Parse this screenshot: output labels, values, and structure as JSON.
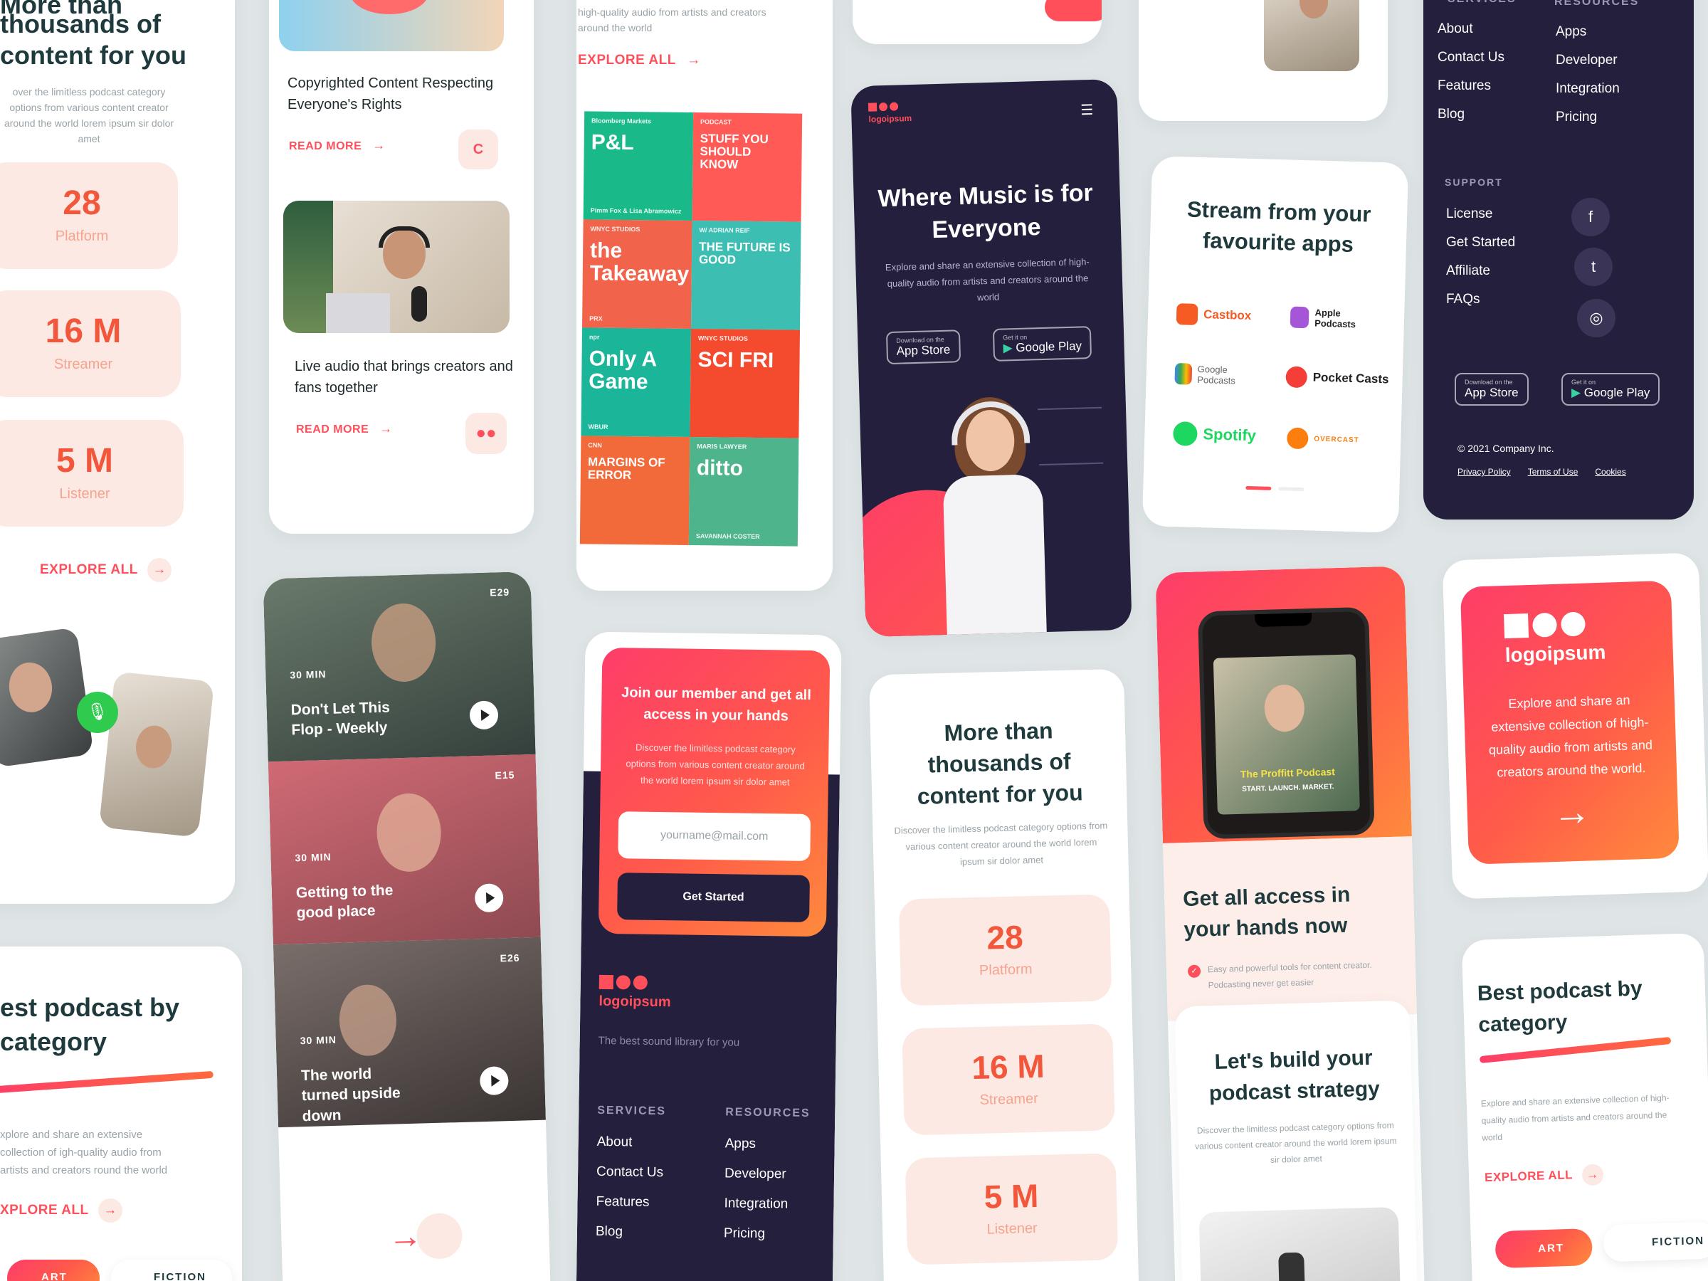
{
  "col1": {
    "heading_top": "More than",
    "heading": "thousands of content for you",
    "desc": "over the limitless podcast category options from various content creator around the world lorem ipsum sir dolor amet",
    "stats": [
      {
        "num": "28",
        "label": "Platform"
      },
      {
        "num": "16 M",
        "label": "Streamer"
      },
      {
        "num": "5 M",
        "label": "Listener"
      }
    ],
    "explore": "EXPLORE ALL",
    "best_title": "est podcast by category",
    "best_desc": "xplore and share an extensive collection of igh-quality audio from artists and creators round the world",
    "explore2": "XPLORE ALL",
    "chips": [
      "ART",
      "FICTION"
    ]
  },
  "col2": {
    "article1": "Copyrighted Content Respecting Everyone's Rights",
    "read_more": "READ MORE",
    "article2": "Live audio that brings creators and fans together",
    "episodes": [
      {
        "code": "E29",
        "dur": "30 MIN",
        "title": "Don't Let This Flop - Weekly"
      },
      {
        "code": "E15",
        "dur": "30 MIN",
        "title": "Getting to the good place"
      },
      {
        "code": "E26",
        "dur": "30 MIN",
        "title": "The world turned upside down"
      }
    ]
  },
  "col3": {
    "top_desc": "high-quality audio from artists and creators around the world",
    "explore": "EXPLORE ALL",
    "tiles": [
      {
        "title": "P&L",
        "sub": "Bloomberg Markets",
        "foot": "Pimm Fox & Lisa Abramowicz",
        "color": "#19b98a"
      },
      {
        "title": "STUFF YOU SHOULD KNOW",
        "sub": "PODCAST",
        "foot": "",
        "color": "#ff5a55"
      },
      {
        "title": "the Takeaway",
        "sub": "WNYC STUDIOS",
        "foot": "PRX",
        "color": "#f1634b"
      },
      {
        "title": "THE FUTURE IS GOOD",
        "sub": "W/ ADRIAN REIF",
        "foot": "",
        "color": "#3cbfb2"
      },
      {
        "title": "Only A Game",
        "sub": "npr",
        "foot": "WBUR",
        "color": "#1bb59a"
      },
      {
        "title": "SCI FRI",
        "sub": "WNYC STUDIOS",
        "foot": "",
        "color": "#f44a2e"
      },
      {
        "title": "MARGINS OF ERROR",
        "sub": "CNN",
        "foot": "",
        "color": "#f26a3a"
      },
      {
        "title": "ditto",
        "sub": "MARIS LAWYER",
        "foot": "SAVANNAH COSTER",
        "color": "#4eb48c"
      }
    ],
    "join_title": "Join our member and get all access in your hands",
    "join_desc": "Discover the limitless podcast category options from various content creator around the world lorem ipsum sir dolor amet",
    "email_placeholder": "yourname@mail.com",
    "get_started": "Get Started",
    "logo": "logoipsum",
    "tagline": "The best sound library for you",
    "services_h": "SERVICES",
    "resources_h": "RESOURCES",
    "services": [
      "About",
      "Contact Us",
      "Features",
      "Blog"
    ],
    "resources": [
      "Apps",
      "Developer",
      "Integration",
      "Pricing"
    ]
  },
  "col4": {
    "logo": "logoipsum",
    "hero": "Where Music is for Everyone",
    "hero_desc": "Explore and share an extensive collection of high-quality audio from artists and creators around the world",
    "app_store_small": "Download on the",
    "app_store": "App Store",
    "play_small": "Get it on",
    "play": "Google Play",
    "more_title": "More than thousands of content for you",
    "more_desc": "Discover the limitless podcast category options from various content creator around the world lorem ipsum sir dolor amet",
    "stats": [
      {
        "num": "28",
        "label": "Platform"
      },
      {
        "num": "16 M",
        "label": "Streamer"
      },
      {
        "num": "5 M",
        "label": "Listener"
      }
    ]
  },
  "col5": {
    "stream_title": "Stream from your favourite apps",
    "apps": [
      "Castbox",
      "Apple Podcasts",
      "Google Podcasts",
      "Pocket Casts",
      "Spotify",
      "OVERCAST"
    ],
    "phone_podcast": "The Proffitt Podcast",
    "phone_podcast_sub": "START. LAUNCH. MARKET.",
    "access_title": "Get all access in your hands now",
    "access_desc": "Easy and powerful tools for content creator. Podcasting never get easier",
    "strategy_title": "Let's build your podcast strategy",
    "strategy_desc": "Discover the limitless podcast category options from various content creator around the world lorem ipsum sir dolor amet"
  },
  "col6": {
    "services_h": "SERVICES",
    "resources_h": "RESOURCES",
    "services": [
      "About",
      "Contact Us",
      "Features",
      "Blog"
    ],
    "resources": [
      "Apps",
      "Developer",
      "Integration",
      "Pricing"
    ],
    "support_h": "SUPPORT",
    "support": [
      "License",
      "Get Started",
      "Affiliate",
      "FAQs"
    ],
    "app_store_small": "Download on the",
    "app_store": "App Store",
    "play_small": "Get it on",
    "play": "Google Play",
    "copyright": "© 2021 Company Inc.",
    "links": [
      "Privacy Policy",
      "Terms of Use",
      "Cookies"
    ],
    "promo_logo": "logoipsum",
    "promo_desc": "Explore and share an extensive collection of high-quality audio from artists and creators around the world.",
    "best_title": "Best podcast by category",
    "best_desc": "Explore and share an extensive collection of high-quality audio from artists and creators around the world",
    "explore": "EXPLORE ALL",
    "chips": [
      "ART",
      "FICTION"
    ]
  }
}
